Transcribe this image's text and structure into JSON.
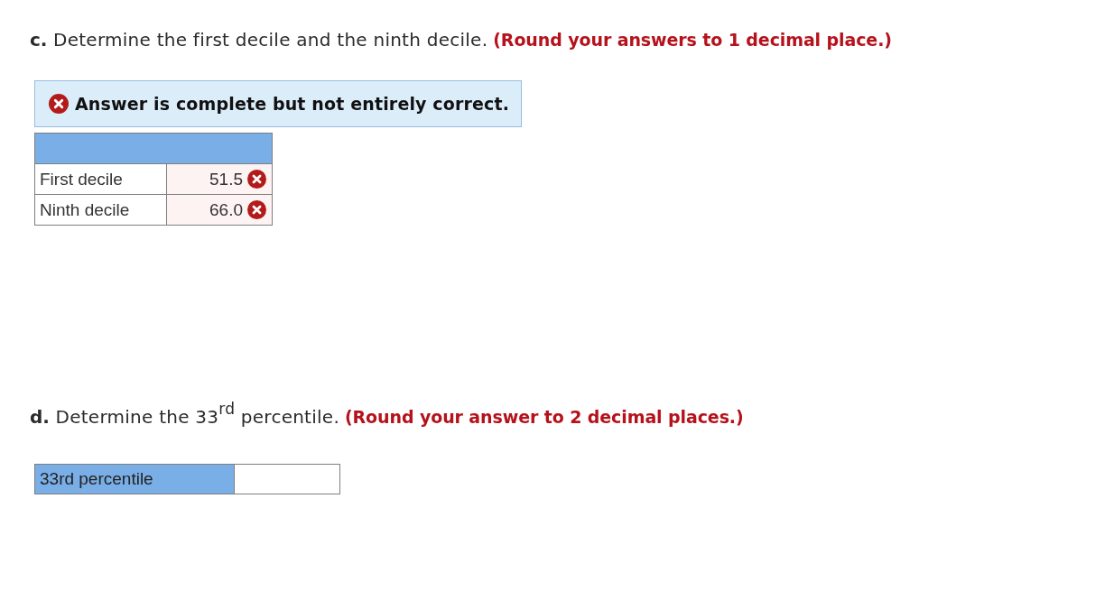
{
  "part_c": {
    "prompt": "**c.** Determine the first decile and the ninth decile.",
    "instruction": "(Round your answers to 1 decimal place.)",
    "feedback": {
      "kind": "partial",
      "message": "Answer is complete but not entirely correct."
    },
    "table": {
      "rows": [
        {
          "label": "First decile",
          "value": "51.5",
          "correct": false
        },
        {
          "label": "Ninth decile",
          "value": "66.0",
          "correct": false
        }
      ]
    }
  },
  "part_d": {
    "prompt": "**d.** Determine the 33$^{rd}$ percentile.",
    "instruction": "(Round your answer to 2 decimal places.)",
    "answers": [
      {
        "label": "33rd percentile"
      }
    ]
  }
}
